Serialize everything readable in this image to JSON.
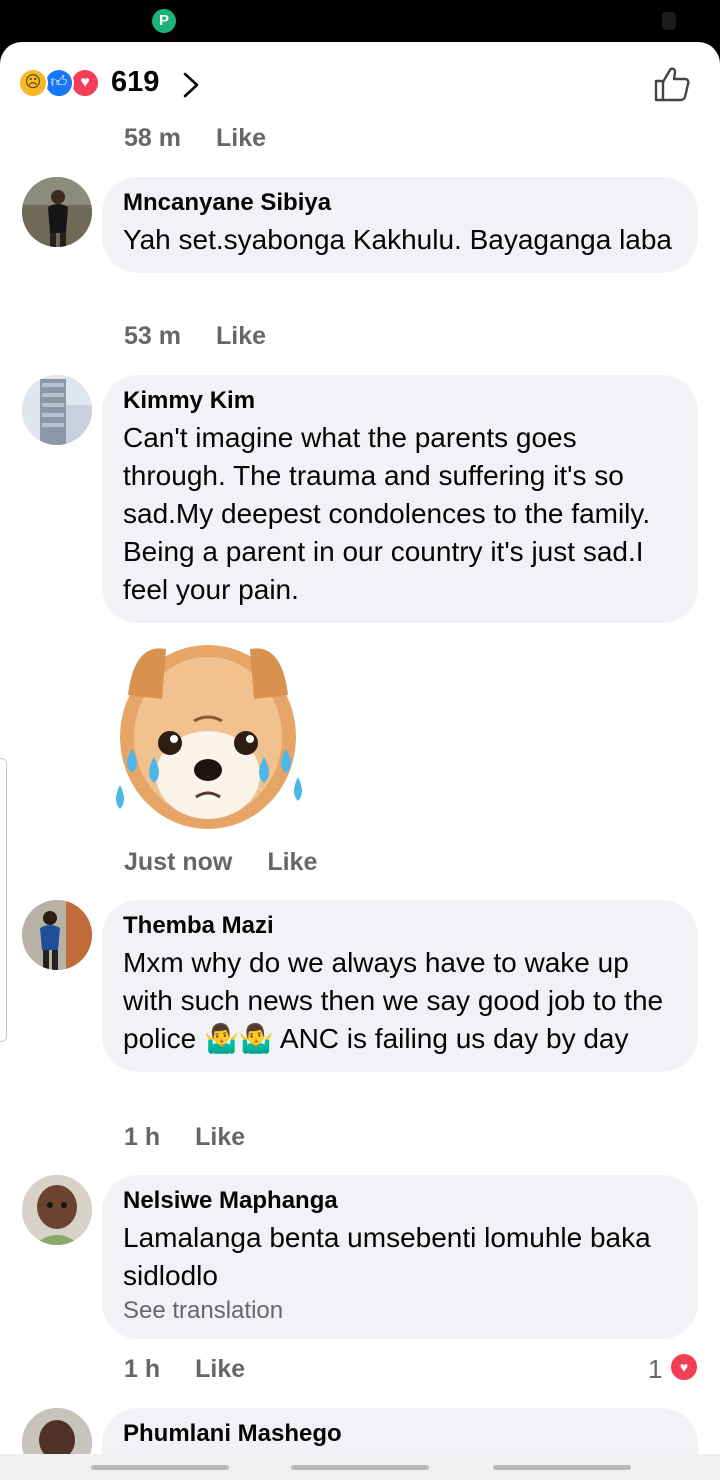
{
  "status_bar": {
    "app_icon_glyph": "P"
  },
  "header": {
    "reaction_count": "619",
    "reaction_icons": [
      "sad-reaction-icon",
      "like-reaction-icon",
      "love-reaction-icon"
    ],
    "icons": {
      "forward": "chevron-right-icon",
      "like": "like-outline-icon"
    }
  },
  "top_meta": {
    "time": "58 m",
    "like": "Like"
  },
  "comments": [
    {
      "author": "Mncanyane  Sibiya",
      "text": "Yah set.syabonga Kakhulu. Bayaganga laba",
      "time": "53 m",
      "like": "Like"
    },
    {
      "author": "Kimmy Kim",
      "text": "Can't imagine what the parents goes through. The trauma and suffering it's so sad.My deepest condolences to the family. Being a parent in our country it's just sad.I  feel your pain.",
      "sticker": "crying-dog-sticker",
      "time": "Just now",
      "like": "Like"
    },
    {
      "author": "Themba Mazi",
      "text": "Mxm why do we always have to wake up with such news then we say good job to the police 🤷‍♂️🤷‍♂️ ANC is failing us day by day",
      "time": "1 h",
      "like": "Like"
    },
    {
      "author": "Nelsiwe Maphanga",
      "text": "Lamalanga benta umsebenti lomuhle baka sidlodlo",
      "see_translation": "See translation",
      "time": "1 h",
      "like": "Like",
      "reaction_count": "1"
    },
    {
      "author": "Phumlani Mashego"
    }
  ],
  "colors": {
    "bubble": "#f0f2f5",
    "meta": "#65676b",
    "like_blue": "#1877f2",
    "love_red": "#f33e58",
    "sad_yellow": "#f7b928"
  }
}
